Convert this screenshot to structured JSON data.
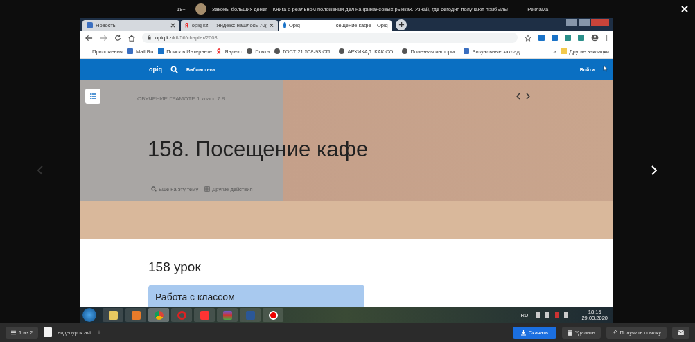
{
  "ad_bar": {
    "age_rating": "18+",
    "title": "Законы больших денег",
    "text": "Книга о реальном положении дел на финансовых рынках. Узнай, где сегодня получают прибыль!",
    "label": "Реклама"
  },
  "browser": {
    "tabs": [
      {
        "title": "Новость",
        "kind": "site",
        "selected": false
      },
      {
        "title": "opiq kz — Яндекс: нашлось 70(",
        "kind": "yandex",
        "selected": false
      },
      {
        "title": "Opiq",
        "title_end": "сещение кафе – Opiq",
        "kind": "opiq",
        "selected": true
      }
    ],
    "url_host": "opiq.kz",
    "url_path": "/kit/56/chapter/2008",
    "bookmarks": [
      {
        "label": "Приложения",
        "kind": "apps"
      },
      {
        "label": "Mail.Ru",
        "kind": "square"
      },
      {
        "label": "Поиск в Интернете",
        "kind": "search"
      },
      {
        "label": "Яндекс",
        "kind": "yandex"
      },
      {
        "label": "Почта",
        "kind": "globe"
      },
      {
        "label": "ГОСТ 21.508-93 СП...",
        "kind": "globe"
      },
      {
        "label": "АРХИКАД: КАК СО...",
        "kind": "globe"
      },
      {
        "label": "Полезная информ...",
        "kind": "globe"
      },
      {
        "label": "Визуальные заклад...",
        "kind": "square"
      }
    ],
    "more_bookmarks": "»",
    "other_bookmarks": "Другие закладки"
  },
  "site": {
    "logo": "opiq",
    "nav_link": "Библиотека",
    "login": "Войти",
    "breadcrumb": "ОБУЧЕНИЕ ГРАМОТЕ 1 класс 7.9",
    "chapter_title": "158. Посещение кафе",
    "more_on_topic": "Еще на эту тему",
    "other_actions": "Другие действия",
    "lesson_heading": "158 урок",
    "card_title": "Работа с классом"
  },
  "taskbar": {
    "language": "RU",
    "time": "18:15",
    "date": "29.03.2020"
  },
  "viewer": {
    "counter": "1 из 2",
    "file_name": "видеоурок.avi",
    "download": "Скачать",
    "delete": "Удалить",
    "get_link": "Получить ссылку"
  }
}
